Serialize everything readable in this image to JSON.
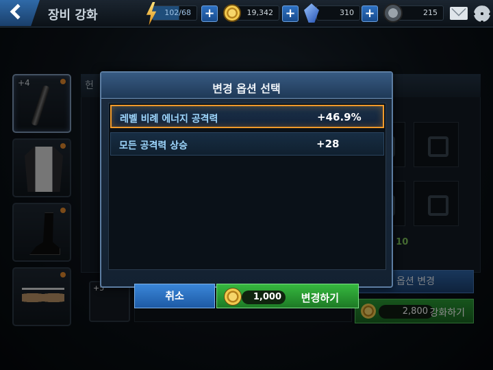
{
  "topbar": {
    "title": "장비 강화",
    "energy": "102/68",
    "coins": "19,342",
    "crystals": "310",
    "tokens": "215",
    "plus_label": "+"
  },
  "slots": [
    {
      "level": "+4",
      "item": "baton"
    },
    {
      "level": "",
      "item": "suit"
    },
    {
      "level": "",
      "item": "boot"
    },
    {
      "level": "",
      "item": "glasses"
    }
  ],
  "background": {
    "header_fragment": "헌",
    "count_text": "l: 10",
    "option_change_label": "옵션 변경",
    "enhance_cost": "2,800",
    "enhance_label": "강화하기",
    "bottom_slot_level": "+5"
  },
  "modal": {
    "title": "변경 옵션 선택",
    "options": [
      {
        "name": "레벨 비례 에너지 공격력",
        "value": "+46.9%",
        "selected": true
      },
      {
        "name": "모든 공격력 상승",
        "value": "+28",
        "selected": false
      }
    ],
    "cancel_label": "취소",
    "confirm_cost": "1,000",
    "confirm_label": "변경하기"
  },
  "colors": {
    "selected_border": "#f19a2a",
    "option_name": "#9fd8ff",
    "cancel_button": "#2a70c2",
    "confirm_button": "#2ea336",
    "count_text": "#7ec25a"
  }
}
